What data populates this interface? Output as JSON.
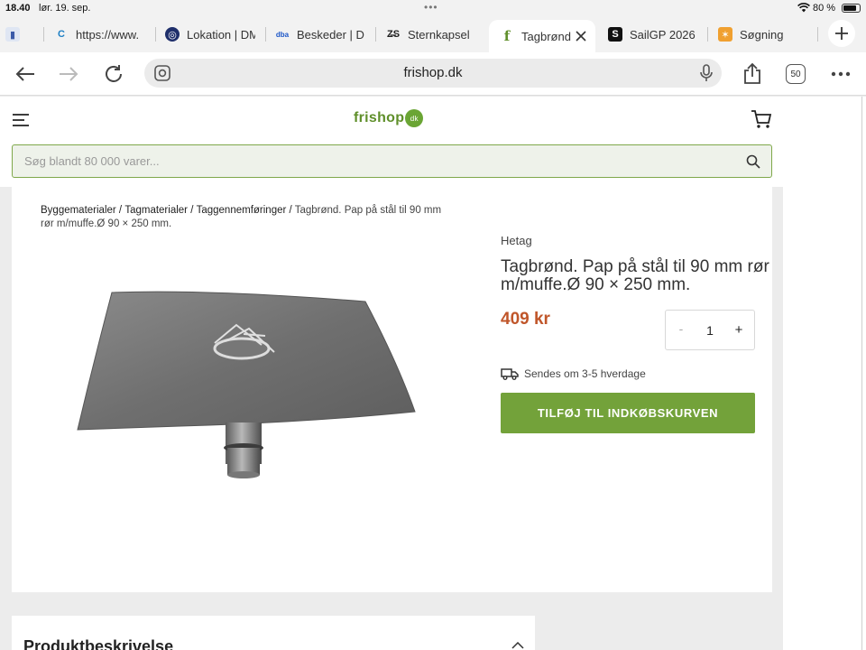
{
  "status_bar": {
    "time": "18.40",
    "date": "lør. 19. sep.",
    "battery": "80 %",
    "battery_level": 0.8
  },
  "tabs": [
    {
      "label": "",
      "icon": "page-icon"
    },
    {
      "label": "https://www.",
      "icon": "c-logo-icon"
    },
    {
      "label": "Lokation | DM",
      "icon": "globe-icon"
    },
    {
      "label": "Beskeder | D",
      "icon": "dba-icon"
    },
    {
      "label": "Sternkapsel",
      "icon": "zs-icon"
    },
    {
      "label": "Tagbrønd",
      "icon": "frishop-f-icon",
      "active": true
    },
    {
      "label": "SailGP 2026",
      "icon": "s-logo-icon"
    },
    {
      "label": "Søgning",
      "icon": "star-logo-icon"
    }
  ],
  "toolbar": {
    "url": "frishop.dk",
    "tab_count": "50"
  },
  "site": {
    "logo_text": "frishop",
    "logo_badge": "dk",
    "search_placeholder": "Søg blandt 80 000 varer..."
  },
  "breadcrumb": {
    "items": [
      "Byggematerialer",
      "Tagmaterialer",
      "Taggennemføringer"
    ],
    "separator": " / ",
    "current": "Tagbrønd. Pap på stål til 90 mm rør m/muffe.Ø 90 × 250 mm."
  },
  "product": {
    "brand": "Hetag",
    "title": "Tagbrønd. Pap på stål til 90 mm rør m/muffe.Ø 90 × 250 mm.",
    "price": "409 kr",
    "quantity": "1",
    "minus": "-",
    "plus": "+",
    "shipping": "Sendes om 3-5 hverdage",
    "add_to_cart": "TILFØJ TIL INDKØBSKURVEN"
  },
  "description": {
    "title": "Produktbeskrivelse"
  },
  "colors": {
    "accent_green": "#73a23a",
    "price_orange": "#c0562a"
  }
}
